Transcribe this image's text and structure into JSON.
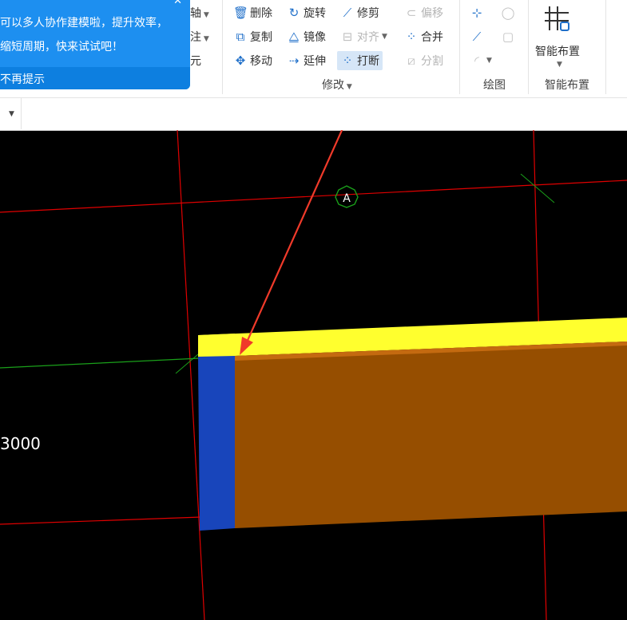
{
  "tip": {
    "line1": "可以多人协作建模啦，提升效率，",
    "line2": "缩短周期，快来试试吧！",
    "footer": "不再提示"
  },
  "left_labels": {
    "axis": "轴",
    "note": "注",
    "unit": "元"
  },
  "modify": {
    "delete": "删除",
    "rotate": "旋转",
    "trim": "修剪",
    "offset": "偏移",
    "copy": "复制",
    "mirror": "镜像",
    "align": "对齐",
    "merge": "合并",
    "move": "移动",
    "extend": "延伸",
    "break": "打断",
    "split": "分割",
    "group_label": "修改"
  },
  "draw": {
    "group_label": "绘图"
  },
  "smart": {
    "button_label": "智能布置",
    "group_label": "智能布置"
  },
  "canvas": {
    "axis_marker": "A",
    "dimension": "3000",
    "colors": {
      "beam_top": "#ffff2e",
      "beam_face": "#964e00",
      "beam_end": "#1845bb",
      "grid": "#e00000",
      "arrow": "#f03a2a"
    }
  }
}
